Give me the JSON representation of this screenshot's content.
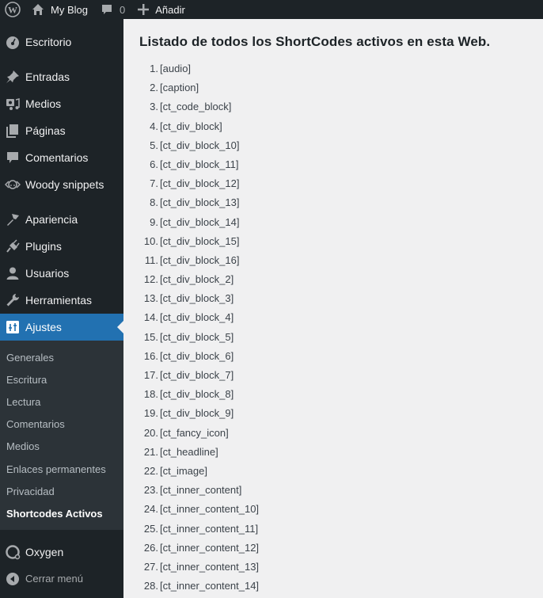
{
  "adminbar": {
    "site_name": "My Blog",
    "comments_count": "0",
    "new_label": "Añadir"
  },
  "sidebar": {
    "items": [
      {
        "label": "Escritorio",
        "icon": "dashboard-icon"
      },
      {
        "label": "Entradas",
        "icon": "pin-icon"
      },
      {
        "label": "Medios",
        "icon": "media-icon"
      },
      {
        "label": "Páginas",
        "icon": "pages-icon"
      },
      {
        "label": "Comentarios",
        "icon": "comment-icon"
      },
      {
        "label": "Woody snippets",
        "icon": "snippets-icon"
      },
      {
        "label": "Apariencia",
        "icon": "brush-icon"
      },
      {
        "label": "Plugins",
        "icon": "plugin-icon"
      },
      {
        "label": "Usuarios",
        "icon": "user-icon"
      },
      {
        "label": "Herramientas",
        "icon": "wrench-icon"
      },
      {
        "label": "Ajustes",
        "icon": "settings-icon"
      }
    ],
    "submenu": [
      "Generales",
      "Escritura",
      "Lectura",
      "Comentarios",
      "Medios",
      "Enlaces permanentes",
      "Privacidad",
      "Shortcodes Activos"
    ],
    "oxygen_label": "Oxygen",
    "collapse_label": "Cerrar menú",
    "accent_color": "#2271b1"
  },
  "main": {
    "title": "Listado de todos los ShortCodes activos en esta Web.",
    "shortcodes": [
      "[audio]",
      "[caption]",
      "[ct_code_block]",
      "[ct_div_block]",
      "[ct_div_block_10]",
      "[ct_div_block_11]",
      "[ct_div_block_12]",
      "[ct_div_block_13]",
      "[ct_div_block_14]",
      "[ct_div_block_15]",
      "[ct_div_block_16]",
      "[ct_div_block_2]",
      "[ct_div_block_3]",
      "[ct_div_block_4]",
      "[ct_div_block_5]",
      "[ct_div_block_6]",
      "[ct_div_block_7]",
      "[ct_div_block_8]",
      "[ct_div_block_9]",
      "[ct_fancy_icon]",
      "[ct_headline]",
      "[ct_image]",
      "[ct_inner_content]",
      "[ct_inner_content_10]",
      "[ct_inner_content_11]",
      "[ct_inner_content_12]",
      "[ct_inner_content_13]",
      "[ct_inner_content_14]"
    ]
  }
}
